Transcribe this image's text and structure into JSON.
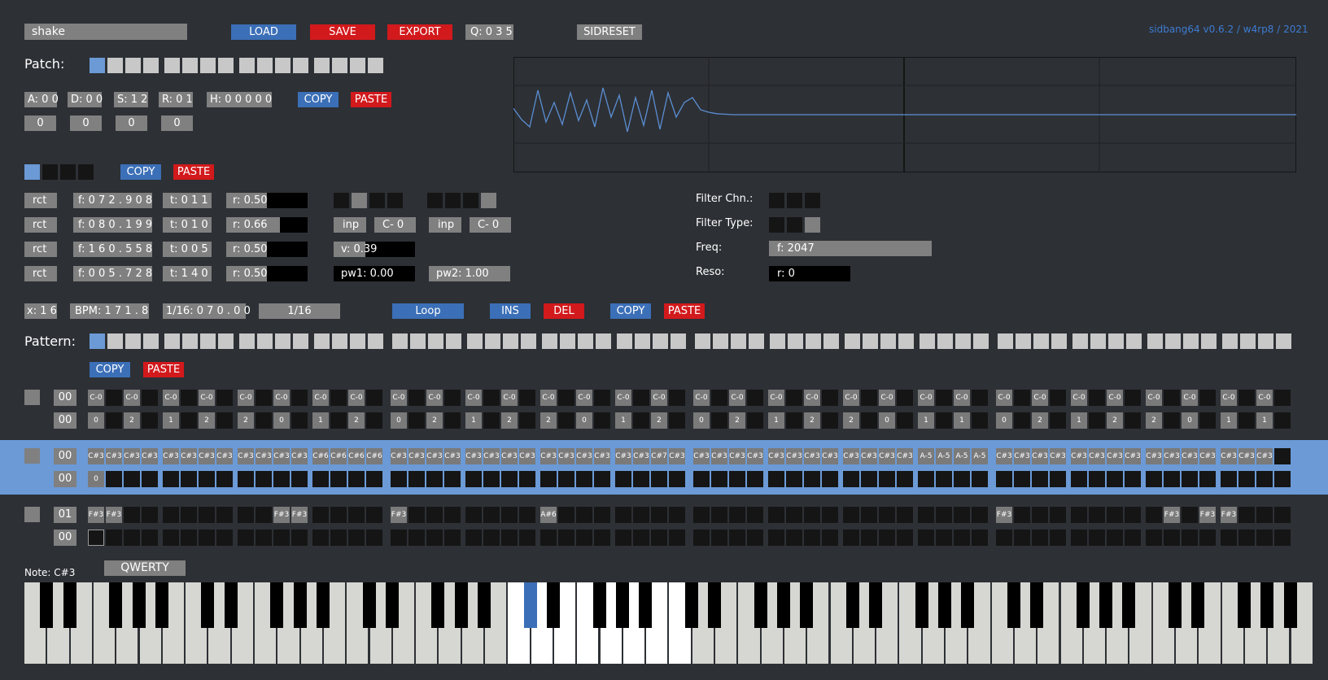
{
  "header": {
    "patch_name": "shake",
    "load": "LOAD",
    "save": "SAVE",
    "export": "EXPORT",
    "q": "Q: 0 3 5",
    "sidreset": "SIDRESET",
    "version": "sidbang64 v0.6.2 / w4rp8 / 2021"
  },
  "patch": {
    "label": "Patch:"
  },
  "adsr": {
    "a": "A: 0 0",
    "d": "D: 0 0",
    "s": "S: 1 2",
    "r": "R: 0 1",
    "h": "H: 0 0 0 0 0",
    "v1": "0",
    "v2": "0",
    "v3": "0",
    "v4": "0",
    "copy": "COPY",
    "paste": "PASTE"
  },
  "osc": {
    "copy": "COPY",
    "paste": "PASTE",
    "rows": [
      {
        "type": "rct",
        "f": "f: 0 7 2 . 9 0 8",
        "t": "t: 0 1 1",
        "r": "r: 0.50"
      },
      {
        "type": "rct",
        "f": "f: 0 8 0 . 1 9 9",
        "t": "t: 0 1 0",
        "r": "r: 0.66"
      },
      {
        "type": "rct",
        "f": "f: 1 6 0 . 5 5 8",
        "t": "t: 0 0 5",
        "r": "r: 0.50"
      },
      {
        "type": "rct",
        "f": "f: 0 0 5 . 7 2 8",
        "t": "t: 1 4 0",
        "r": "r: 0.50"
      }
    ],
    "ratio_levels": [
      0.5,
      0.66,
      0.5,
      0.5
    ],
    "inp1": "inp",
    "note1": "C-  0",
    "inp2": "inp",
    "note2": "C-  0",
    "v": "v: 0.39",
    "v_level": 0.39,
    "pw1": "pw1: 0.00",
    "pw2": "pw2: 1.00"
  },
  "filter": {
    "chn_label": "Filter Chn.:",
    "type_label": "Filter Type:",
    "freq_label": "Freq:",
    "reso_label": "Reso:",
    "freq": "f: 2047",
    "reso": "r: 0"
  },
  "transport": {
    "x": "x: 1 6",
    "bpm": "BPM: 1 7 1 . 8",
    "step": "1/16: 0 7 0 . 0 0",
    "div": "1/16",
    "loop": "Loop",
    "ins": "INS",
    "del": "DEL",
    "copy": "COPY",
    "paste": "PASTE"
  },
  "pattern": {
    "label": "Pattern:",
    "copy": "COPY",
    "paste": "PASTE"
  },
  "tracks": [
    {
      "top_id": "00",
      "bot_id": "00",
      "notes": [
        "C-0",
        "",
        "C-0",
        "",
        "C-0",
        "",
        "C-0",
        "",
        "C-0",
        "",
        "C-0",
        "",
        "C-0",
        "",
        "C-0",
        "",
        "C-0",
        "",
        "C-0",
        "",
        "C-0",
        "",
        "C-0",
        "",
        "C-0",
        "",
        "C-0",
        "",
        "C-0",
        "",
        "C-0",
        "",
        "C-0",
        "",
        "C-0",
        "",
        "C-0",
        "",
        "C-0",
        "",
        "C-0",
        "",
        "C-0",
        "",
        "C-0",
        "",
        "C-0",
        "",
        "C-0",
        "",
        "C-0",
        "",
        "C-0",
        "",
        "C-0",
        "",
        "C-0",
        "",
        "C-0",
        "",
        "C-0",
        "",
        "C-0",
        "",
        "C-0",
        ""
      ],
      "vals": [
        "0",
        "",
        "2",
        "",
        "1",
        "",
        "2",
        "",
        "2",
        "",
        "0",
        "",
        "1",
        "",
        "2",
        "",
        "0",
        "",
        "2",
        "",
        "1",
        "",
        "2",
        "",
        "2",
        "",
        "0",
        "",
        "1",
        "",
        "2",
        "",
        "0",
        "",
        "2",
        "",
        "1",
        "",
        "2",
        "",
        "2",
        "",
        "0",
        "",
        "1",
        "",
        "1",
        "",
        "0",
        "",
        "2",
        "",
        "1",
        "",
        "2",
        "",
        "2",
        "",
        "0",
        "",
        "1",
        "",
        "1",
        ""
      ]
    },
    {
      "top_id": "00",
      "bot_id": "00",
      "notes": [
        "C#3",
        "C#3",
        "C#3",
        "C#3",
        "C#3",
        "C#3",
        "C#3",
        "C#3",
        "C#3",
        "C#3",
        "C#3",
        "C#3",
        "C#6",
        "C#6",
        "C#6",
        "C#6",
        "C#3",
        "C#3",
        "C#3",
        "C#3",
        "C#3",
        "C#3",
        "C#3",
        "C#3",
        "C#3",
        "C#3",
        "C#3",
        "C#3",
        "C#3",
        "C#3",
        "C#7",
        "C#3",
        "C#3",
        "C#3",
        "C#3",
        "C#3",
        "C#3",
        "C#3",
        "C#3",
        "C#3",
        "C#3",
        "C#3",
        "C#3",
        "C#3",
        "A-5",
        "A-5",
        "A-5",
        "A-5",
        "C#3",
        "C#3",
        "C#3",
        "C#3",
        "C#3",
        "C#3",
        "C#3",
        "C#3",
        "C#3",
        "C#3",
        "C#3",
        "C#3",
        "C#3",
        "C#3",
        "C#3",
        ""
      ],
      "vals": [
        "0",
        "",
        "",
        "",
        "",
        "",
        "",
        "",
        "",
        "",
        "",
        "",
        "",
        "",
        "",
        "",
        "",
        "",
        "",
        "",
        "",
        "",
        "",
        "",
        "",
        "",
        "",
        "",
        "",
        "",
        "",
        "",
        "",
        "",
        "",
        "",
        "",
        "",
        "",
        "",
        "",
        "",
        "",
        "",
        "",
        "",
        "",
        "",
        "",
        "",
        "",
        "",
        "",
        "",
        "",
        "",
        "",
        "",
        "",
        "",
        "",
        "",
        "",
        ""
      ]
    },
    {
      "top_id": "01",
      "bot_id": "00",
      "notes": [
        "F#3",
        "F#3",
        "",
        "",
        "",
        "",
        "",
        "",
        "",
        "",
        "F#3",
        "F#3",
        "",
        "",
        "",
        "",
        "F#3",
        "",
        "",
        "",
        "",
        "",
        "",
        "",
        "A#6",
        "",
        "",
        "",
        "",
        "",
        "",
        "",
        "",
        "",
        "",
        "",
        "",
        "",
        "",
        "",
        "",
        "",
        "",
        "",
        "",
        "",
        "",
        "",
        "F#3",
        "",
        "",
        "",
        "",
        "",
        "",
        "",
        "",
        "F#3",
        "",
        "F#3",
        "F#3",
        "",
        "",
        ""
      ],
      "vals": [
        "",
        "",
        "",
        "",
        "",
        "",
        "",
        "",
        "",
        "",
        "",
        "",
        "",
        "",
        "",
        "",
        "",
        "",
        "",
        "",
        "",
        "",
        "",
        "",
        "",
        "",
        "",
        "",
        "",
        "",
        "",
        "",
        "",
        "",
        "",
        "",
        "",
        "",
        "",
        "",
        "",
        "",
        "",
        "",
        "",
        "",
        "",
        "",
        "",
        "",
        "",
        "",
        "",
        "",
        "",
        "",
        "",
        "",
        "",
        "",
        "",
        "",
        "",
        ""
      ]
    }
  ],
  "keyboard": {
    "note_label": "Note: C#3",
    "mode": "QWERTY"
  },
  "waveform": {
    "points": [
      0.13,
      -0.1,
      -0.25,
      0.5,
      -0.15,
      0.25,
      -0.2,
      0.45,
      -0.12,
      0.3,
      -0.25,
      0.55,
      -0.05,
      0.4,
      -0.35,
      0.35,
      -0.22,
      0.5,
      -0.3,
      0.45,
      -0.05,
      0.25,
      0.35,
      0.1,
      0.05,
      0.02,
      0.01,
      0,
      0,
      0
    ]
  }
}
